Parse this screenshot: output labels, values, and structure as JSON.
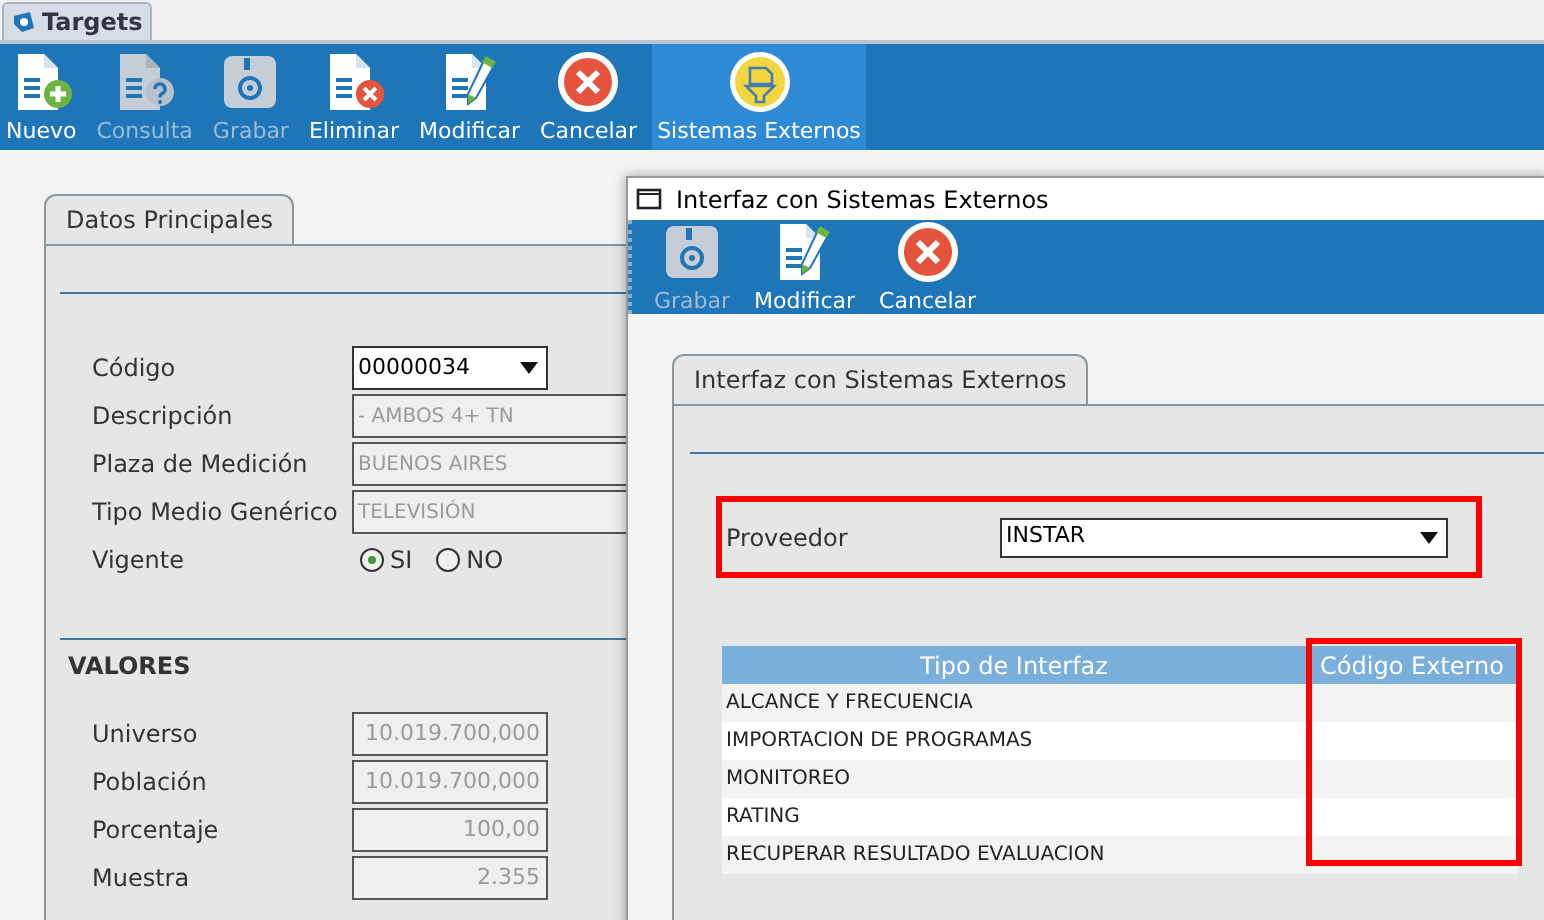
{
  "app_tab": {
    "title": "Targets"
  },
  "toolbar": [
    {
      "label": "Nuevo",
      "kind": "new",
      "disabled": false,
      "selected": false
    },
    {
      "label": "Consulta",
      "kind": "query",
      "disabled": true,
      "selected": false
    },
    {
      "label": "Grabar",
      "kind": "save",
      "disabled": true,
      "selected": false
    },
    {
      "label": "Eliminar",
      "kind": "delete",
      "disabled": false,
      "selected": false
    },
    {
      "label": "Modificar",
      "kind": "edit",
      "disabled": false,
      "selected": false
    },
    {
      "label": "Cancelar",
      "kind": "cancel",
      "disabled": false,
      "selected": false
    },
    {
      "label": "Sistemas Externos",
      "kind": "external",
      "disabled": false,
      "selected": true
    }
  ],
  "main_form": {
    "tab": "Datos Principales",
    "fields": [
      {
        "label": "Código",
        "value": "00000034",
        "kind": "dropdown"
      },
      {
        "label": "Descripción",
        "value": "- AMBOS 4+ TN",
        "kind": "text"
      },
      {
        "label": "Plaza de Medición",
        "value": "BUENOS AIRES",
        "kind": "text"
      },
      {
        "label": "Tipo Medio Genérico",
        "value": "TELEVISIÓN",
        "kind": "text"
      }
    ],
    "vigente": {
      "label": "Vigente",
      "options": [
        {
          "label": "SI",
          "selected": true
        },
        {
          "label": "NO",
          "selected": false
        }
      ]
    },
    "section": "VALORES",
    "values": [
      {
        "label": "Universo",
        "value": "10.019.700,000"
      },
      {
        "label": "Población",
        "value": "10.019.700,000"
      },
      {
        "label": "Porcentaje",
        "value": "100,00"
      },
      {
        "label": "Muestra",
        "value": "2.355"
      }
    ]
  },
  "dialog": {
    "title": "Interfaz con Sistemas Externos",
    "toolbar": [
      {
        "label": "Grabar",
        "kind": "save",
        "disabled": true
      },
      {
        "label": "Modificar",
        "kind": "edit",
        "disabled": false
      },
      {
        "label": "Cancelar",
        "kind": "cancel",
        "disabled": false
      }
    ],
    "tab": "Interfaz con Sistemas Externos",
    "provider": {
      "label": "Proveedor",
      "value": "INSTAR"
    },
    "table": {
      "columns": [
        "Tipo de Interfaz",
        "Código Externo"
      ],
      "rows": [
        {
          "cells": [
            "ALCANCE Y FRECUENCIA"
          ]
        },
        {
          "cells": [
            "IMPORTACION DE PROGRAMAS"
          ]
        },
        {
          "cells": [
            "MONITOREO"
          ]
        },
        {
          "cells": [
            "RATING"
          ]
        },
        {
          "cells": [
            "RECUPERAR RESULTADO EVALUACION"
          ]
        }
      ]
    }
  }
}
